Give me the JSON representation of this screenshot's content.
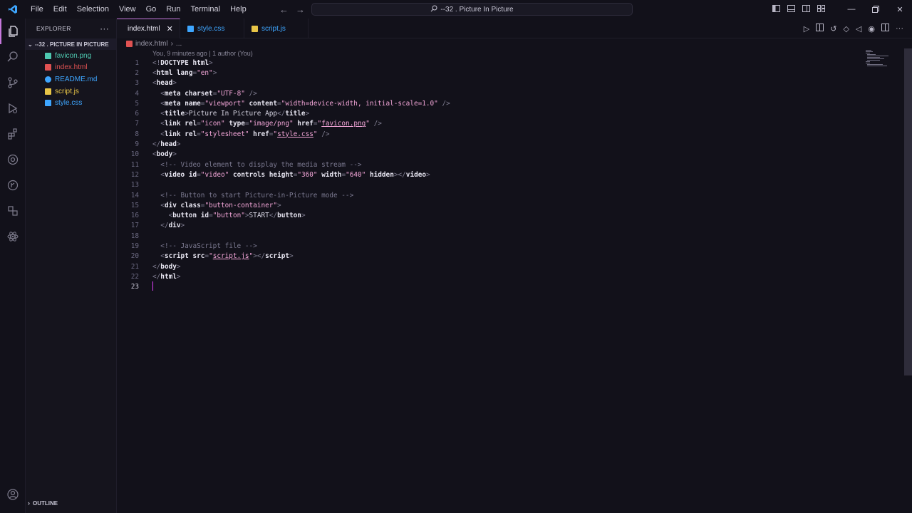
{
  "app": {
    "icon": "vscode-logo-icon"
  },
  "menu": [
    "File",
    "Edit",
    "Selection",
    "View",
    "Go",
    "Run",
    "Terminal",
    "Help"
  ],
  "command_center": {
    "text": "--32 . Picture In Picture"
  },
  "window_controls": [
    "minimize-icon",
    "restore-icon",
    "close-icon"
  ],
  "sidebar": {
    "header": "EXPLORER",
    "folder": "--32 . PICTURE IN PICTURE",
    "files": [
      {
        "name": "favicon.png",
        "color": "#4ec9b0"
      },
      {
        "name": "index.html",
        "color": "#e05252"
      },
      {
        "name": "README.md",
        "color": "#3ea6ff"
      },
      {
        "name": "script.js",
        "color": "#e8c547"
      },
      {
        "name": "style.css",
        "color": "#3ea6ff"
      }
    ],
    "outline": "OUTLINE"
  },
  "tabs": [
    {
      "label": "index.html",
      "active": true
    },
    {
      "label": "style.css",
      "active": false
    },
    {
      "label": "script.js",
      "active": false
    }
  ],
  "breadcrumb": {
    "file": "index.html",
    "rest": "..."
  },
  "blame": "You, 9 minutes ago | 1 author (You)",
  "editor": {
    "line_numbers": [
      "1",
      "2",
      "3",
      "4",
      "5",
      "6",
      "7",
      "8",
      "9",
      "10",
      "11",
      "12",
      "13",
      "14",
      "15",
      "16",
      "17",
      "18",
      "19",
      "20",
      "21",
      "22",
      "23"
    ],
    "cursor_line": 23
  },
  "colors": {
    "background": "#12111a",
    "accent": "#c678dd",
    "string": "#f3a6d8",
    "cursor": "#e040fb"
  }
}
